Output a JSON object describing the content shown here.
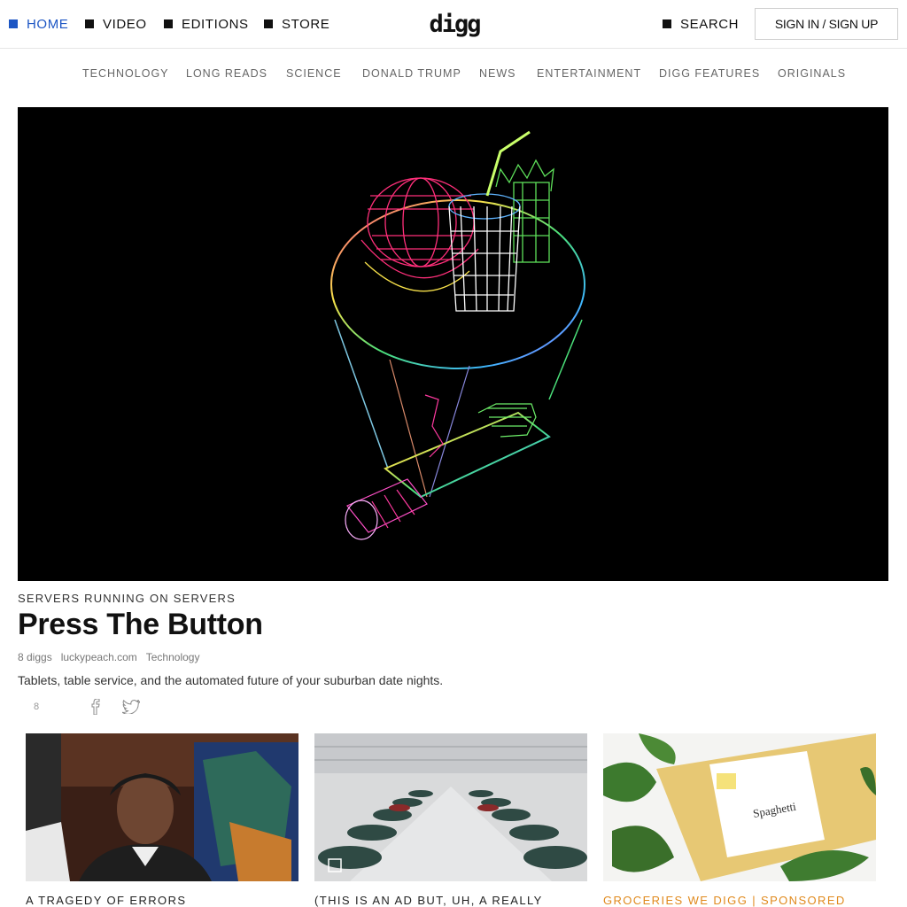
{
  "topnav": {
    "home": "HOME",
    "video": "VIDEO",
    "editions": "EDITIONS",
    "store": "STORE",
    "logo": "digg",
    "search": "SEARCH",
    "signin": "SIGN IN / SIGN UP"
  },
  "categories": [
    "TECHNOLOGY",
    "LONG READS",
    "SCIENCE",
    "DONALD TRUMP",
    "NEWS",
    "ENTERTAINMENT",
    "DIGG FEATURES",
    "ORIGINALS"
  ],
  "hero": {
    "kicker": "SERVERS RUNNING ON SERVERS",
    "headline": "Press The Button",
    "diggs": "8 diggs",
    "source": "luckypeach.com",
    "category": "Technology",
    "description": "Tablets, table service, and the automated future of your suburban date nights.",
    "digg_count": "8"
  },
  "cards": [
    {
      "label": "A TRAGEDY OF ERRORS",
      "label_color": "#222222"
    },
    {
      "label": "(THIS IS AN AD BUT, UH, A REALLY",
      "label_color": "#222222"
    },
    {
      "label": "GROCERIES WE DIGG | SPONSORED",
      "label_color": "#e0891c"
    }
  ],
  "colors": {
    "accent": "#1d56c4",
    "sponsored": "#e0891c"
  }
}
